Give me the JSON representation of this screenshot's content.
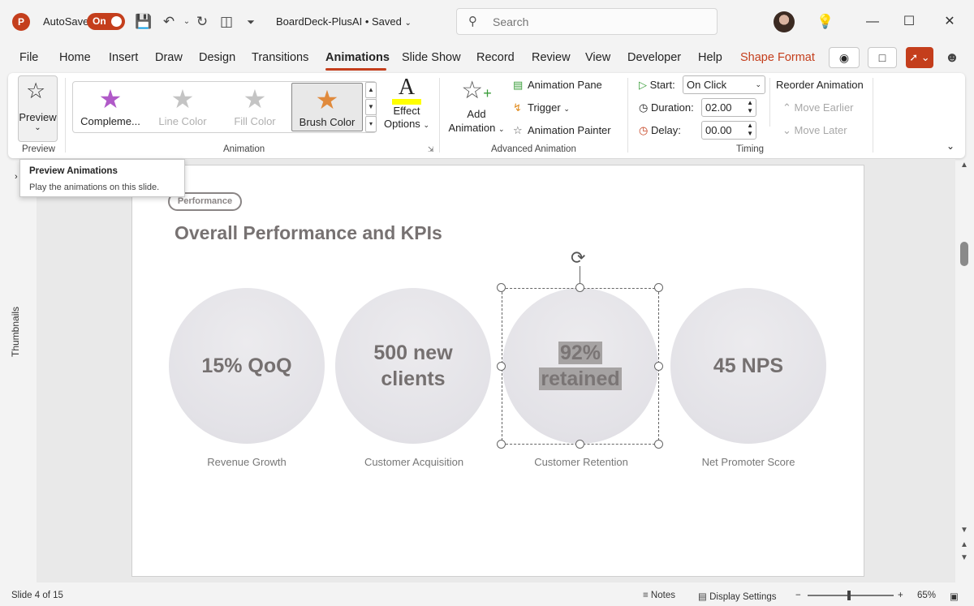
{
  "app": {
    "logo": "P",
    "autosave_label": "AutoSave",
    "autosave_state": "On",
    "doc_title": "BoardDeck-PlusAI • Saved",
    "search_placeholder": "Search",
    "accent_color": "#c43e1c"
  },
  "menu": {
    "tabs": [
      "File",
      "Home",
      "Insert",
      "Draw",
      "Design",
      "Transitions",
      "Animations",
      "Slide Show",
      "Record",
      "Review",
      "View",
      "Developer",
      "Help",
      "Shape Format"
    ],
    "active": "Animations"
  },
  "ribbon": {
    "preview": {
      "label": "Preview",
      "group": "Preview"
    },
    "animation_gallery": {
      "items": [
        {
          "label": "Compleme...",
          "icon": "star-purple-icon",
          "state": "normal"
        },
        {
          "label": "Line Color",
          "icon": "star-gray-icon",
          "state": "disabled"
        },
        {
          "label": "Fill Color",
          "icon": "star-gray-icon",
          "state": "disabled"
        },
        {
          "label": "Brush Color",
          "icon": "star-brush-icon",
          "state": "selected"
        }
      ],
      "effect_options_label_1": "Effect",
      "effect_options_label_2": "Options",
      "group": "Animation"
    },
    "advanced": {
      "add_animation_1": "Add",
      "add_animation_2": "Animation",
      "animation_pane": "Animation Pane",
      "trigger": "Trigger",
      "animation_painter": "Animation Painter",
      "group": "Advanced Animation"
    },
    "timing": {
      "start_label": "Start:",
      "start_value": "On Click",
      "duration_label": "Duration:",
      "duration_value": "02.00",
      "delay_label": "Delay:",
      "delay_value": "00.00",
      "reorder_title": "Reorder Animation",
      "move_earlier": "Move Earlier",
      "move_later": "Move Later",
      "group": "Timing"
    }
  },
  "tooltip": {
    "title": "Preview Animations",
    "body": "Play the animations on this slide."
  },
  "thumbnails_label": "Thumbnails",
  "slide": {
    "tag": "Performance",
    "title": "Overall Performance and KPIs",
    "kpis": [
      {
        "value_1": "15% QoQ",
        "value_2": "",
        "label": "Revenue Growth"
      },
      {
        "value_1": "500 new",
        "value_2": "clients",
        "label": "Customer Acquisition"
      },
      {
        "value_1": "92%",
        "value_2": "retained",
        "label": "Customer Retention"
      },
      {
        "value_1": "45 NPS",
        "value_2": "",
        "label": "Net Promoter Score"
      }
    ]
  },
  "status": {
    "slide_counter": "Slide 4 of 15",
    "notes": "Notes",
    "display_settings": "Display Settings",
    "zoom": "65%"
  }
}
